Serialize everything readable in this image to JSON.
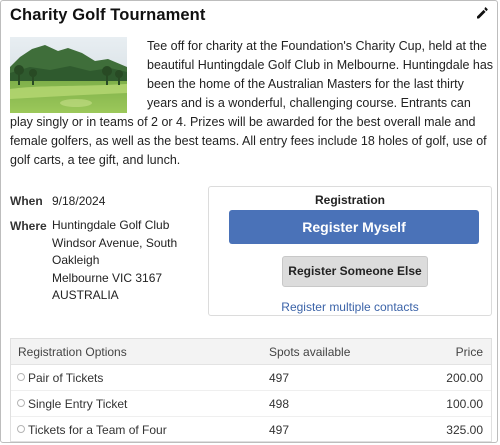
{
  "event": {
    "title": "Charity Golf Tournament",
    "description": "Tee off for charity at the Foundation's Charity Cup, held at the beautiful Huntingdale Golf Club in Melbourne. Huntingdale has been the home of the Australian Masters for the last thirty years and is a wonderful, challenging course. Entrants can play singly or in teams of 2 or 4. Prizes will be awarded for the best overall male and female golfers, as well as the best teams. All entry fees include 18 holes of golf, use of golf carts, a tee gift, and lunch.",
    "image_icon": "golf-course-photo",
    "edit_icon": "pencil-icon"
  },
  "details": {
    "when_label": "When",
    "when_value": "9/18/2024",
    "where_label": "Where",
    "where_lines": [
      "Huntingdale Golf Club",
      "Windsor Avenue, South",
      "Oakleigh",
      "Melbourne VIC 3167",
      "AUSTRALIA"
    ]
  },
  "registration": {
    "heading": "Registration",
    "register_myself": "Register Myself",
    "register_someone_else": "Register Someone Else",
    "register_multiple": "Register multiple contacts"
  },
  "options": {
    "headers": {
      "name": "Registration Options",
      "spots": "Spots available",
      "price": "Price"
    },
    "rows": [
      {
        "name": "Pair of Tickets",
        "spots": "497",
        "price": "200.00"
      },
      {
        "name": "Single Entry Ticket",
        "spots": "498",
        "price": "100.00"
      },
      {
        "name": "Tickets for a Team of Four",
        "spots": "497",
        "price": "325.00"
      }
    ]
  },
  "colors": {
    "primary_button": "#4a72b8",
    "link": "#3b63a8",
    "secondary_button": "#dcdcdc"
  }
}
